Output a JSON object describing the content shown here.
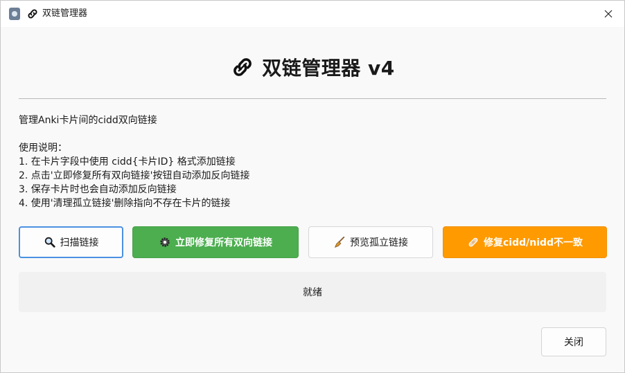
{
  "window": {
    "title": "双链管理器"
  },
  "header": {
    "title": "双链管理器 v4"
  },
  "description": "管理Anki卡片间的cidd双向链接",
  "instructions": {
    "heading": "使用说明：",
    "lines": [
      "1. 在卡片字段中使用 cidd{卡片ID} 格式添加链接",
      "2. 点击'立即修复所有双向链接'按钮自动添加反向链接",
      "3. 保存卡片时也会自动添加反向链接",
      "4. 使用'清理孤立链接'删除指向不存在卡片的链接"
    ]
  },
  "buttons": {
    "scan": "扫描链接",
    "fix_all": "立即修复所有双向链接",
    "preview_orphans": "预览孤立链接",
    "fix_nidd": "修复cidd/nidd不一致"
  },
  "status": "就绪",
  "close_button": "关闭",
  "icons": {
    "scan": "magnifier-icon",
    "fix_all": "gear-icon",
    "preview_orphans": "broom-icon",
    "fix_nidd": "bandage-icon",
    "header": "link-icon"
  },
  "colors": {
    "fix_all_bg": "#4cae4f",
    "fix_nidd_bg": "#ff9a00",
    "scan_border": "#4a90e2"
  }
}
